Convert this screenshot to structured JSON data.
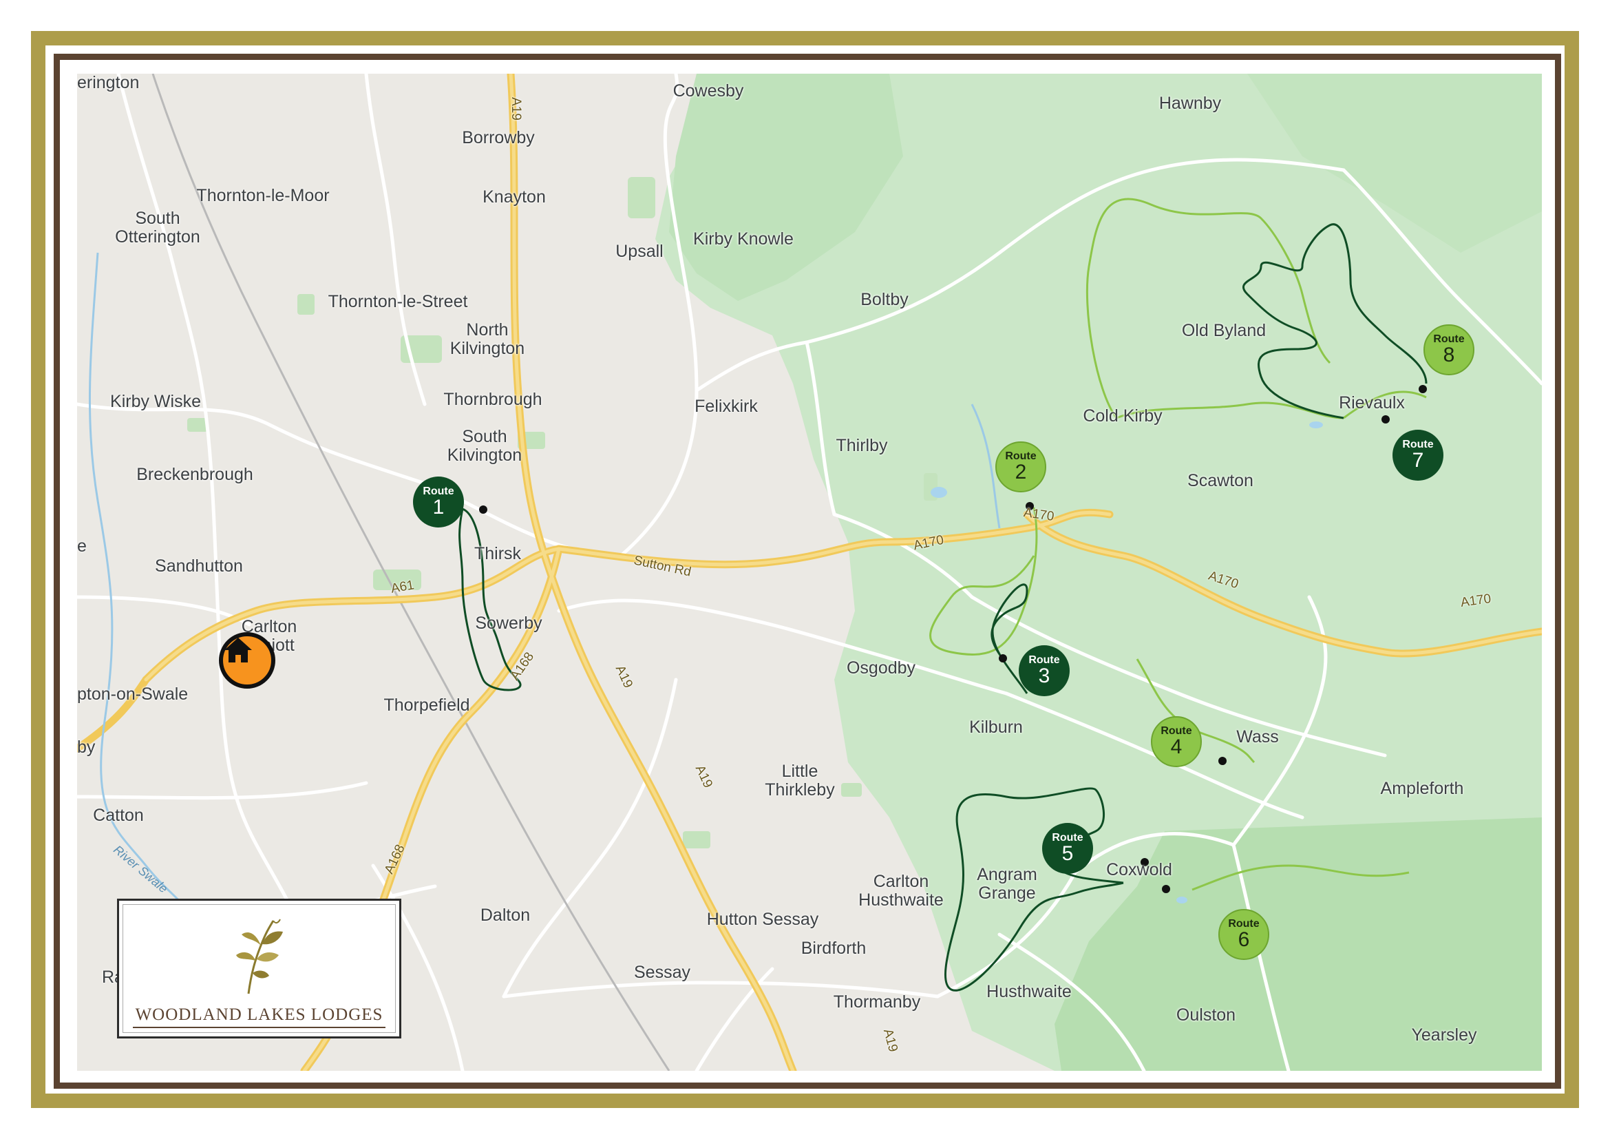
{
  "places": [
    {
      "name": "erington"
    },
    {
      "name": "Cowesby"
    },
    {
      "name": "Hawnby"
    },
    {
      "name": "Borrowby"
    },
    {
      "name": "Thornton-le-Moor"
    },
    {
      "name": "Knayton"
    },
    {
      "name": "South\nOtterington"
    },
    {
      "name": "Upsall"
    },
    {
      "name": "Kirby Knowle"
    },
    {
      "name": "Thornton-le-Street"
    },
    {
      "name": "Boltby"
    },
    {
      "name": "North\nKilvington"
    },
    {
      "name": "Old Byland"
    },
    {
      "name": "Kirby Wiske"
    },
    {
      "name": "Thornbrough"
    },
    {
      "name": "Felixkirk"
    },
    {
      "name": "Rievaulx"
    },
    {
      "name": "Cold Kirby"
    },
    {
      "name": "South\nKilvington"
    },
    {
      "name": "Thirlby"
    },
    {
      "name": "Breckenbrough"
    },
    {
      "name": "Scawton"
    },
    {
      "name": "Thirsk"
    },
    {
      "name": "Sandhutton"
    },
    {
      "name": "e"
    },
    {
      "name": "Carlton\nMiniott"
    },
    {
      "name": "Sowerby"
    },
    {
      "name": "Osgodby"
    },
    {
      "name": "pton-on-Swale"
    },
    {
      "name": "Thorpefield"
    },
    {
      "name": "Kilburn"
    },
    {
      "name": "Wass"
    },
    {
      "name": "by"
    },
    {
      "name": "Little\nThirkleby"
    },
    {
      "name": "Ampleforth"
    },
    {
      "name": "Catton"
    },
    {
      "name": "Angram\nGrange"
    },
    {
      "name": "Carlton\nHusthwaite"
    },
    {
      "name": "Coxwold"
    },
    {
      "name": "Dalton"
    },
    {
      "name": "Hutton Sessay"
    },
    {
      "name": "Birdforth"
    },
    {
      "name": "Ra"
    },
    {
      "name": "Sessay"
    },
    {
      "name": "Husthwaite"
    },
    {
      "name": "Thormanby"
    },
    {
      "name": "Oulston"
    },
    {
      "name": "Yearsley"
    }
  ],
  "roads": [
    {
      "name": "A19"
    },
    {
      "name": "A61"
    },
    {
      "name": "Sutton Rd"
    },
    {
      "name": "A170"
    },
    {
      "name": "A170"
    },
    {
      "name": "A170"
    },
    {
      "name": "A170"
    },
    {
      "name": "A168"
    },
    {
      "name": "A168"
    },
    {
      "name": "A19"
    },
    {
      "name": "A19"
    },
    {
      "name": "A19"
    }
  ],
  "rivers": [
    {
      "name": "River Swale"
    }
  ],
  "routes": [
    {
      "label": "Route",
      "number": "1",
      "style": "dark"
    },
    {
      "label": "Route",
      "number": "2",
      "style": "light"
    },
    {
      "label": "Route",
      "number": "3",
      "style": "dark"
    },
    {
      "label": "Route",
      "number": "4",
      "style": "light"
    },
    {
      "label": "Route",
      "number": "5",
      "style": "dark"
    },
    {
      "label": "Route",
      "number": "6",
      "style": "light"
    },
    {
      "label": "Route",
      "number": "7",
      "style": "dark"
    },
    {
      "label": "Route",
      "number": "8",
      "style": "light"
    }
  ],
  "home_marker": {
    "icon": "home-icon"
  },
  "logo": {
    "text": "WOODLAND LAKES LODGES"
  },
  "colors": {
    "frame_outer": "#ad9d4a",
    "frame_inner": "#5b4331",
    "park": "#c9e6c6",
    "route_dark": "#0f4d25",
    "route_light": "#8dc649",
    "home": "#f7931e"
  }
}
